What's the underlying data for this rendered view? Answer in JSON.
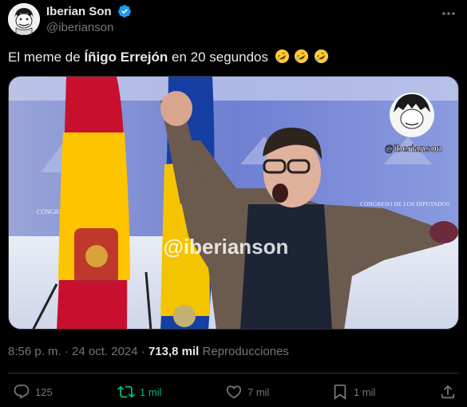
{
  "author": {
    "display_name": "Iberian Son",
    "handle": "@iberianson",
    "verified": true
  },
  "tweet": {
    "text_before": "El meme de ",
    "text_bold": "Íñigo Errejón",
    "text_after": " en 20 segundos",
    "emojis": [
      "rolling-on-floor-laughing",
      "rolling-on-floor-laughing",
      "rolling-on-floor-laughing"
    ]
  },
  "media": {
    "watermark_center": "@iberianson",
    "watermark_corner": "@iberianson",
    "backdrop_text_left": "CONGRESO",
    "backdrop_text_right": "CONGRESO DE LOS DIPUTADOS"
  },
  "meta": {
    "time": "8:56 p. m.",
    "separator": "·",
    "date": "24 oct. 2024",
    "views_count": "713,8 mil",
    "views_label": "Reproducciones"
  },
  "actions": {
    "replies": "125",
    "retweets": "1 mil",
    "likes": "7 mil",
    "bookmarks": "1 mil"
  },
  "colors": {
    "background": "#000000",
    "text": "#e7e9ea",
    "secondary": "#71767b",
    "retweet_active": "#00ba7c",
    "verified": "#1d9bf0",
    "divider": "#2f3336"
  }
}
